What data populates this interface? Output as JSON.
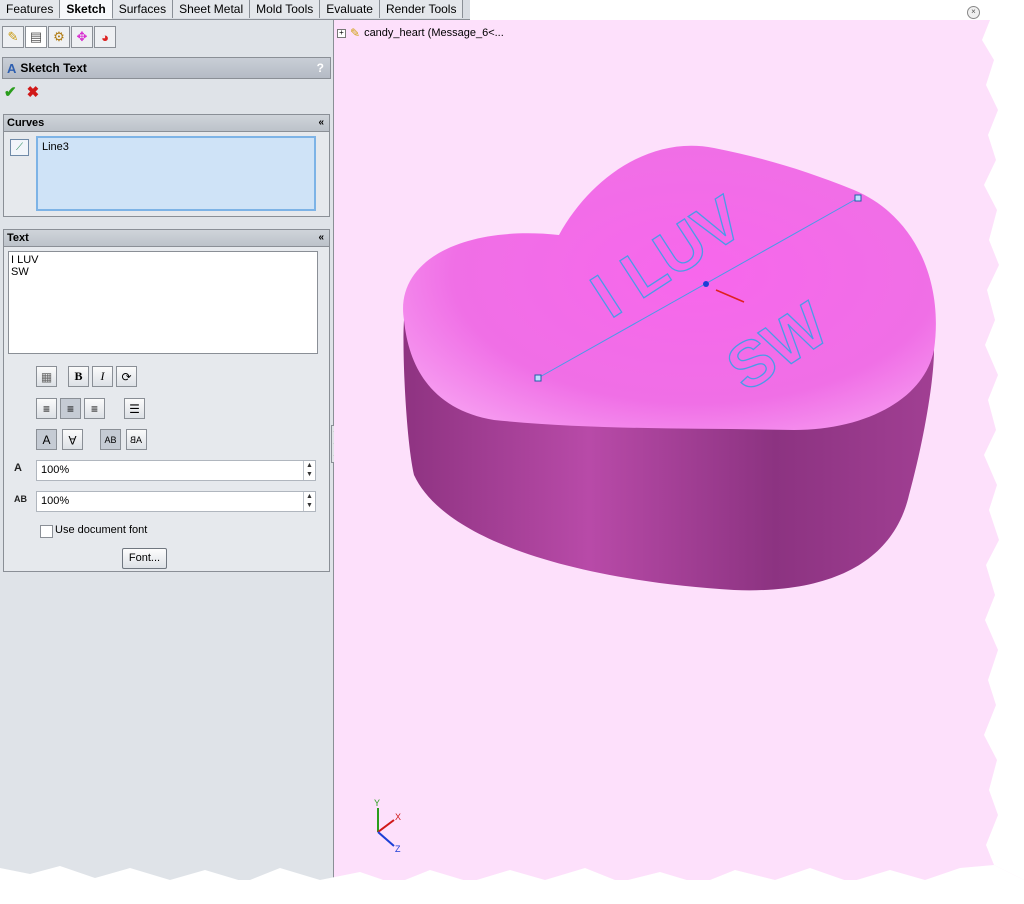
{
  "tabs": [
    "Features",
    "Sketch",
    "Surfaces",
    "Sheet Metal",
    "Mold Tools",
    "Evaluate",
    "Render Tools"
  ],
  "active_tab": "Sketch",
  "property_manager": {
    "title": "Sketch Text",
    "help": "?",
    "ok_symbol": "✔",
    "cancel_symbol": "✖"
  },
  "curves": {
    "header": "Curves",
    "collapse": "«",
    "items": [
      "Line3"
    ]
  },
  "text_section": {
    "header": "Text",
    "collapse": "«",
    "content": "I LUV\nSW",
    "bold_label": "B",
    "italic_label": "I",
    "width_factor": "100%",
    "spacing": "100%",
    "width_icon_label": "A",
    "spacing_icon_label": "AB",
    "use_doc_font_label": "Use document font",
    "use_doc_font_checked": false,
    "font_button": "Font..."
  },
  "feature_tree": {
    "label": "candy_heart  (Message_6<..."
  },
  "model_text": {
    "line1": "I LUV",
    "line2": "SW"
  },
  "triad": {
    "x": "X",
    "y": "Y",
    "z": "Z"
  },
  "colors": {
    "viewport_bg": "#fde0fb",
    "heart_top": "#f46bea",
    "heart_side": "#a83e98",
    "sketch_blue": "#4a9be8"
  }
}
